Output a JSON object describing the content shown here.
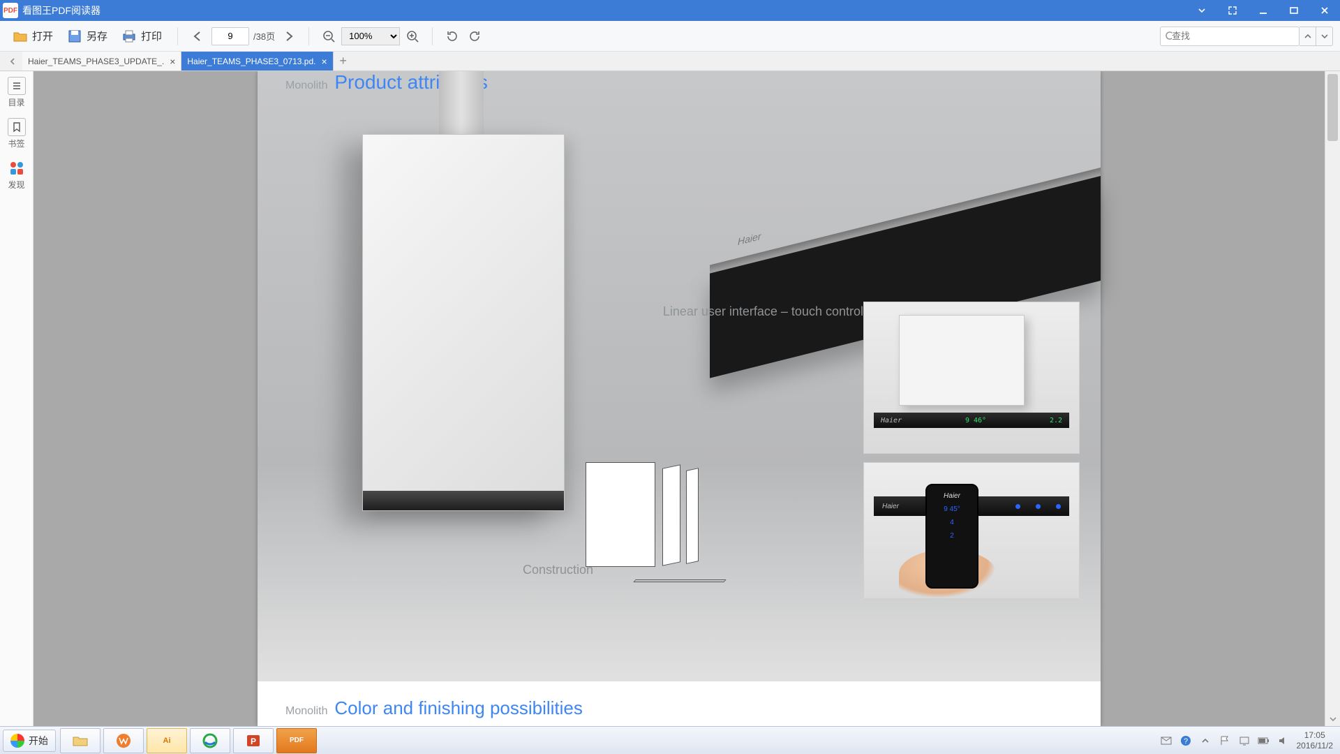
{
  "app": {
    "title": "看图王PDF阅读器"
  },
  "toolbar": {
    "open": "打开",
    "save": "另存",
    "print": "打印",
    "page_current": "9",
    "page_total": "/38页",
    "zoom_value": "100%",
    "search_placeholder": "查找"
  },
  "tabs": {
    "inactive": "Haier_TEAMS_PHASE3_UPDATE_.",
    "active": "Haier_TEAMS_PHASE3_0713.pd."
  },
  "sidebar": {
    "toc": "目录",
    "bookmark": "书签",
    "discover": "发现"
  },
  "document": {
    "header_prefix": "Monolith",
    "header_main": "Product attributes",
    "label_interface": "Linear user interface – touch control",
    "label_construction": "Construction",
    "footer_prefix": "Monolith",
    "footer_main": "Color and finishing possibilities",
    "brand": "Haier",
    "panel_readout_left": "9 46°",
    "panel_readout_right": "2.2",
    "phone_rows": [
      "9  45°",
      "4",
      "2"
    ]
  },
  "taskbar": {
    "start": "开始",
    "apps": {
      "ai": "Ai",
      "ppt": "P",
      "pdf": "PDF"
    },
    "clock_time": "17:05",
    "clock_date": "2016/11/2"
  }
}
